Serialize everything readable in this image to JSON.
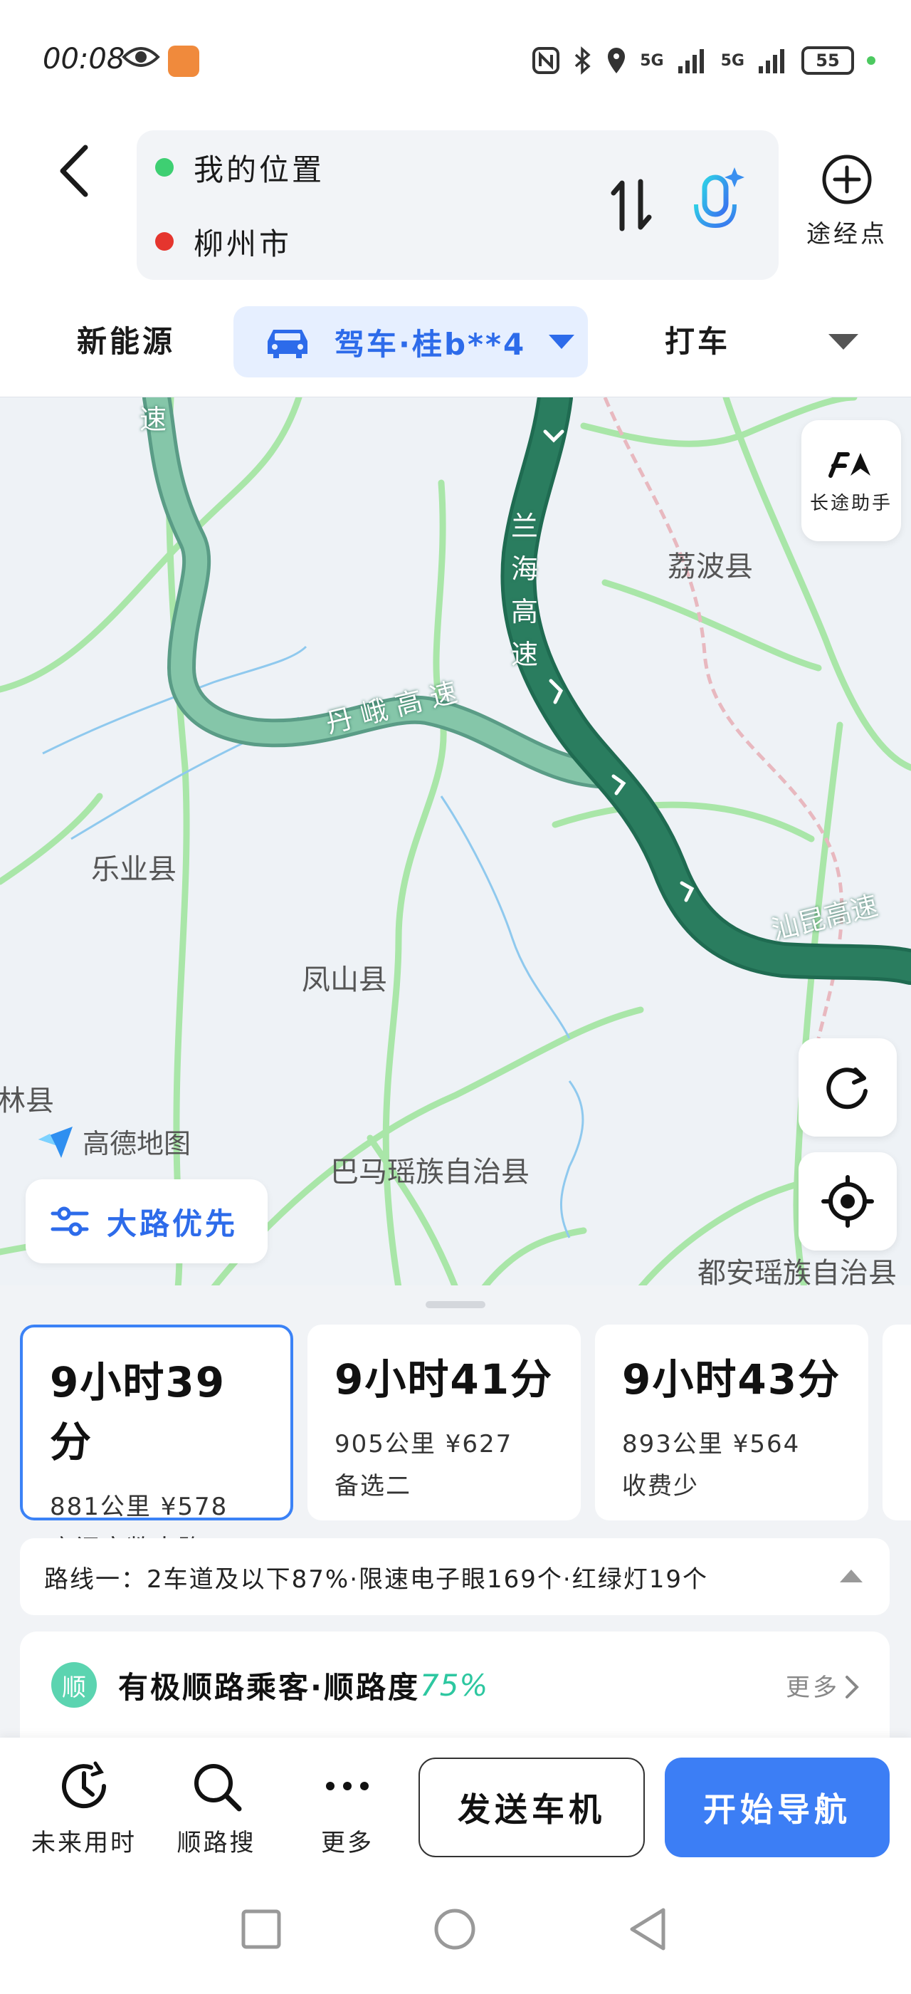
{
  "status_bar": {
    "time": "00:08",
    "signal_1": "5G",
    "signal_2": "5G",
    "battery": "55"
  },
  "route": {
    "origin": "我的位置",
    "destination": "柳州市",
    "origin_color": "#3ecf72",
    "destination_color": "#e5352e",
    "waypoint_label": "途经点"
  },
  "tabs": {
    "new_energy": "新能源",
    "drive": "驾车·桂b**4",
    "taxi": "打车"
  },
  "map": {
    "places": [
      "荔波县",
      "乐业县",
      "凤山县",
      "林县",
      "巴马瑶族自治县",
      "都安瑶族自治县"
    ],
    "roads": {
      "lanhai": [
        "兰",
        "海",
        "高",
        "速"
      ],
      "dane": "丹 峨 高 速",
      "shankun": "汕昆高速",
      "top_fragment": "速"
    },
    "brand": "高德地图",
    "long_trip_label": "长途助手",
    "preference_label": "大路优先",
    "route_primary_color": "#2a7d5f",
    "route_alt_color": "#7fc4a6"
  },
  "route_options": [
    {
      "time": "9小时39分",
      "distance": "881公里",
      "price": "¥578",
      "tag": "夜间宽敞大路"
    },
    {
      "time": "9小时41分",
      "distance": "905公里",
      "price": "¥627",
      "tag": "备选二"
    },
    {
      "time": "9小时43分",
      "distance": "893公里",
      "price": "¥564",
      "tag": "收费少"
    }
  ],
  "route_summary": "路线一：2车道及以下87%·限速电子眼169个·红绿灯19个",
  "carpool": {
    "badge": "顺",
    "text": "有极顺路乘客·顺路度",
    "percent": "75%",
    "more": "更多"
  },
  "actions": {
    "future_time": "未来用时",
    "along_search": "顺路搜",
    "more": "更多",
    "send_to_car": "发送车机",
    "start_nav": "开始导航"
  }
}
